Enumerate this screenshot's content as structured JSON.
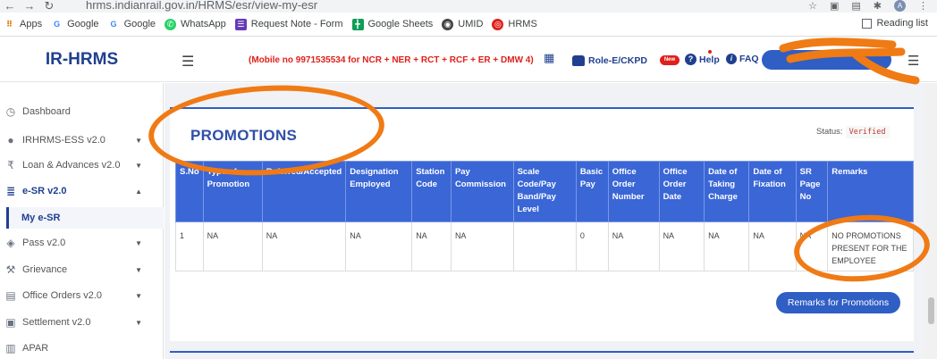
{
  "browser": {
    "url": "hrms.indianrail.gov.in/HRMS/esr/view-my-esr",
    "avatar_letter": "A",
    "bookmarks": [
      {
        "label": "Apps",
        "icon": "apps-grid-icon",
        "color": "#e37400"
      },
      {
        "label": "Google",
        "icon": "google-icon",
        "color": "#4285f4"
      },
      {
        "label": "Google",
        "icon": "google-icon",
        "color": "#4285f4"
      },
      {
        "label": "WhatsApp",
        "icon": "whatsapp-icon",
        "color": "#25d366"
      },
      {
        "label": "Request Note - Form",
        "icon": "form-icon",
        "color": "#673ab7"
      },
      {
        "label": "Google Sheets",
        "icon": "sheets-icon",
        "color": "#0f9d58"
      },
      {
        "label": "UMID",
        "icon": "globe-icon",
        "color": "#444444"
      },
      {
        "label": "HRMS",
        "icon": "hrms-icon",
        "color": "#e0201b"
      }
    ],
    "reading_list": "Reading list"
  },
  "header": {
    "brand": "IR-HRMS",
    "notice": "(Mobile no 9971535534 for NCR + NER + RCT + RCF + ER + DMW 4)",
    "role": "Role-E/CKPD",
    "new_badge": "New",
    "help": "Help",
    "faq": "FAQ"
  },
  "sidebar": {
    "items": [
      {
        "label": "Dashboard",
        "icon": "dashboard-icon"
      },
      {
        "label": "IRHRMS-ESS v2.0",
        "icon": "user-icon"
      },
      {
        "label": "Loan & Advances v2.0",
        "icon": "rupee-icon"
      },
      {
        "label": "e-SR v2.0",
        "icon": "database-icon"
      },
      {
        "label": "Pass v2.0",
        "icon": "ticket-icon"
      },
      {
        "label": "Grievance",
        "icon": "gavel-icon"
      },
      {
        "label": "Office Orders v2.0",
        "icon": "document-icon"
      },
      {
        "label": "Settlement v2.0",
        "icon": "money-icon"
      },
      {
        "label": "APAR",
        "icon": "id-card-icon"
      }
    ],
    "sub_active": "My e-SR"
  },
  "main": {
    "title": "PROMOTIONS",
    "status_label": "Status:",
    "status_value": "Verified",
    "columns": [
      "S.No",
      "Type of Promotion",
      "Referred/Accepted",
      "Designation Employed",
      "Station Code",
      "Pay Commission",
      "Scale Code/Pay Band/Pay Level",
      "Basic Pay",
      "Office Order Number",
      "Office Order Date",
      "Date of Taking Charge",
      "Date of Fixation",
      "SR Page No",
      "Remarks"
    ],
    "rows": [
      [
        "1",
        "NA",
        "NA",
        "NA",
        "NA",
        "NA",
        "",
        "0",
        "NA",
        "NA",
        "NA",
        "NA",
        "NA",
        "NO PROMOTIONS PRESENT FOR THE EMPLOYEE"
      ]
    ],
    "remarks_button": "Remarks for Promotions"
  },
  "colors": {
    "brand_blue": "#1f3f8f",
    "table_header": "#3a66d6",
    "notice_red": "#e0201b",
    "annotation_orange": "#f07a14"
  }
}
